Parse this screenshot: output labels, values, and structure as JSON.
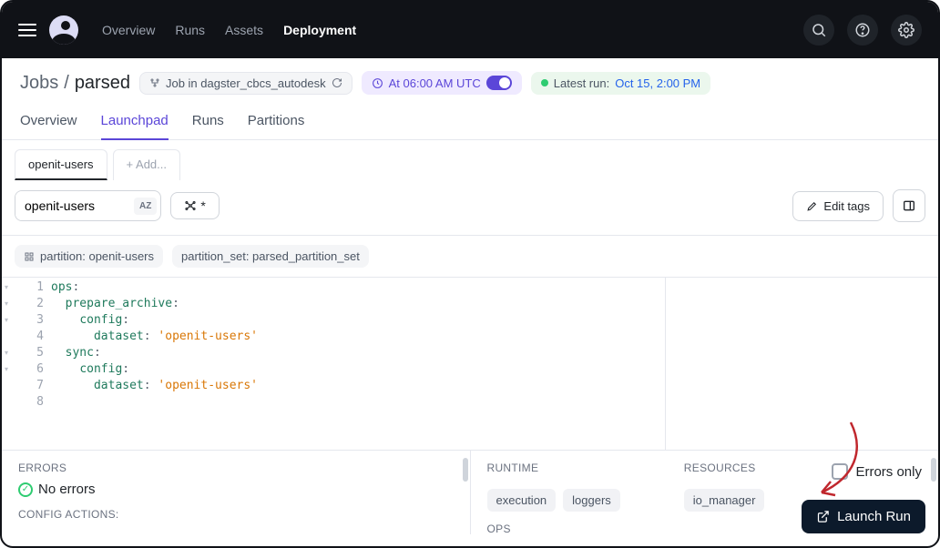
{
  "nav": {
    "items": [
      "Overview",
      "Runs",
      "Assets",
      "Deployment"
    ],
    "active": "Deployment"
  },
  "breadcrumb": {
    "root": "Jobs",
    "sep": "/",
    "current": "parsed"
  },
  "chips": {
    "repo_prefix": "Job in",
    "repo": "dagster_cbcs_autodesk",
    "schedule": "At 06:00 AM UTC",
    "latest_label": "Latest run:",
    "latest_value": "Oct 15, 2:00 PM"
  },
  "tabs": {
    "items": [
      "Overview",
      "Launchpad",
      "Runs",
      "Partitions"
    ],
    "active": "Launchpad"
  },
  "sessions": {
    "active": "openit-users",
    "add": "+ Add..."
  },
  "partition_input": {
    "value": "openit-users",
    "sort_label": "AZ",
    "ops_filter": "*"
  },
  "toolbar": {
    "edit_tags": "Edit tags"
  },
  "config_tags": {
    "partition": "partition: openit-users",
    "partition_set": "partition_set: parsed_partition_set"
  },
  "editor": {
    "lines": [
      {
        "n": 1,
        "fold": true,
        "html": "<span class='ck'>ops</span><span class='cp'>:</span>"
      },
      {
        "n": 2,
        "fold": true,
        "html": "  <span class='ck'>prepare_archive</span><span class='cp'>:</span>"
      },
      {
        "n": 3,
        "fold": true,
        "html": "    <span class='ck'>config</span><span class='cp'>:</span>"
      },
      {
        "n": 4,
        "fold": false,
        "html": "      <span class='ck'>dataset</span><span class='cp'>:</span> <span class='cs'>'openit-users'</span>"
      },
      {
        "n": 5,
        "fold": true,
        "html": "  <span class='ck'>sync</span><span class='cp'>:</span>"
      },
      {
        "n": 6,
        "fold": true,
        "html": "    <span class='ck'>config</span><span class='cp'>:</span>"
      },
      {
        "n": 7,
        "fold": false,
        "html": "      <span class='ck'>dataset</span><span class='cp'>:</span> <span class='cs'>'openit-users'</span>"
      },
      {
        "n": 8,
        "fold": false,
        "html": ""
      }
    ]
  },
  "panels": {
    "errors_title": "ERRORS",
    "no_errors": "No errors",
    "config_actions_title": "CONFIG ACTIONS:",
    "runtime_title": "RUNTIME",
    "resources_title": "RESOURCES",
    "runtime_badges": [
      "execution",
      "loggers"
    ],
    "resource_badges": [
      "io_manager"
    ],
    "ops_title": "OPS",
    "errors_only": "Errors only"
  },
  "launch": {
    "label": "Launch Run"
  }
}
